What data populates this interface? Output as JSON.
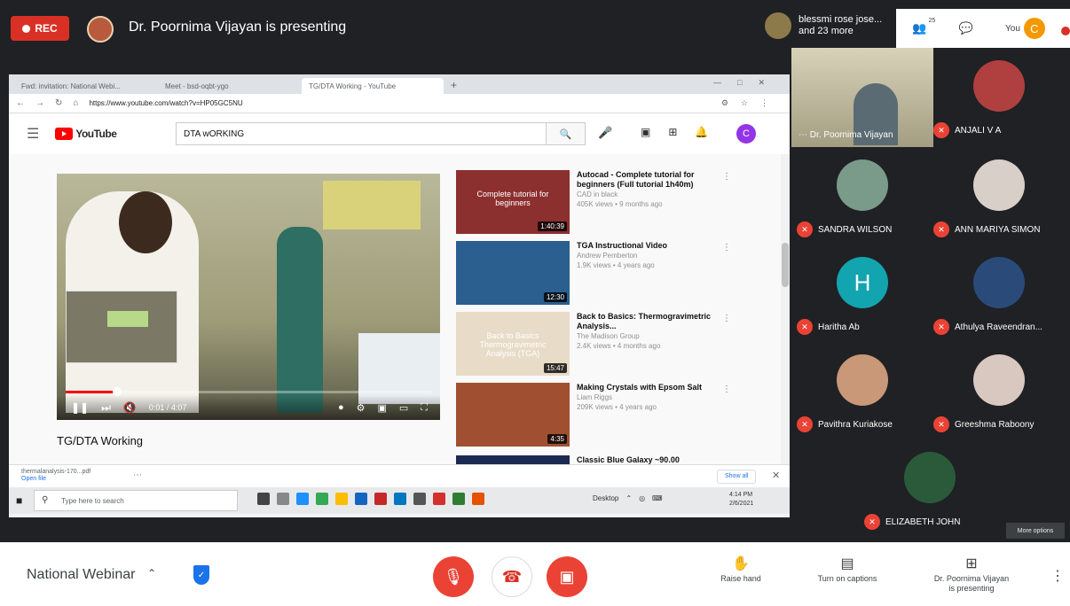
{
  "top": {
    "rec_label": "REC",
    "presenting_title": "Dr. Poornima Vijayan is presenting",
    "others_line1": "blessmi rose jose...",
    "others_line2": "and 23 more",
    "people_count": "25",
    "you_label": "You",
    "you_initial": "C"
  },
  "browser": {
    "tabs": [
      {
        "label": "Fwd: invitation: National Webi...",
        "active": false
      },
      {
        "label": "Meet - bsd-oqbt-ygo",
        "active": false
      },
      {
        "label": "TG/DTA Working - YouTube",
        "active": true
      }
    ],
    "url": "https://www.youtube.com/watch?v=HP05GC5NU"
  },
  "youtube": {
    "logo_text": "YouTube",
    "search_value": "DTA wORKING",
    "avatar_initial": "C",
    "video_time": "0:01 / 4:07",
    "video_title": "TG/DTA Working",
    "progress": 0.14,
    "recommendations": [
      {
        "title": "Autocad - Complete tutorial for beginners (Full tutorial 1h40m)",
        "channel": "CAD in black",
        "meta": "405K views • 9 months ago",
        "duration": "1:40:39",
        "thumb_text": "Complete tutorial for beginners",
        "thumb_color": "#8c2f2f"
      },
      {
        "title": "TGA Instructional Video",
        "channel": "Andrew Pemberton",
        "meta": "1.9K views • 4 years ago",
        "duration": "12:30",
        "thumb_text": "",
        "thumb_color": "#2a5f8f"
      },
      {
        "title": "Back to Basics: Thermogravimetric Analysis...",
        "channel": "The Madison Group",
        "meta": "2.4K views • 4 months ago",
        "duration": "15:47",
        "thumb_text": "Back to Basics Thermogravimetric Analysis (TGA)",
        "thumb_color": "#e8dcc8"
      },
      {
        "title": "Making Crystals with Epsom Salt",
        "channel": "Liam Riggs",
        "meta": "209K views • 4 years ago",
        "duration": "4:35",
        "thumb_text": "",
        "thumb_color": "#a05030"
      }
    ],
    "partial_rec_title": "Classic Blue Galaxy ~90.00"
  },
  "downloads": {
    "file_name": "thermalanalysis-170...pdf",
    "file_status": "Open file",
    "show_all": "Show all"
  },
  "taskbar": {
    "search_placeholder": "Type here to search",
    "tray_label": "Desktop",
    "clock_time": "4:14 PM",
    "clock_date": "2/6/2021"
  },
  "participants": {
    "self_name": "Dr. Poornima Vijayan",
    "tiles": [
      {
        "name": "ANJALI V A",
        "color": "#b04040",
        "initial": ""
      },
      {
        "name": "SANDRA WILSON",
        "color": "#7a9a8a",
        "initial": ""
      },
      {
        "name": "ANN MARIYA SIMON",
        "color": "#d8d0c8",
        "initial": ""
      },
      {
        "name": "Haritha Ab",
        "color": "#12a4af",
        "initial": "H"
      },
      {
        "name": "Athulya Raveendran...",
        "color": "#2a4a7a",
        "initial": ""
      },
      {
        "name": "Pavithra Kuriakose",
        "color": "#c89878",
        "initial": ""
      },
      {
        "name": "Greeshma Raboony",
        "color": "#d8c8c0",
        "initial": ""
      },
      {
        "name": "ELIZABETH JOHN",
        "color": "#2a5a3a",
        "initial": ""
      }
    ],
    "more_options": "More options"
  },
  "bottom": {
    "meeting_name": "National Webinar",
    "raise_hand": "Raise hand",
    "captions": "Turn on captions",
    "presenting_line1": "Dr. Poornima Vijayan",
    "presenting_line2": "is presenting"
  }
}
